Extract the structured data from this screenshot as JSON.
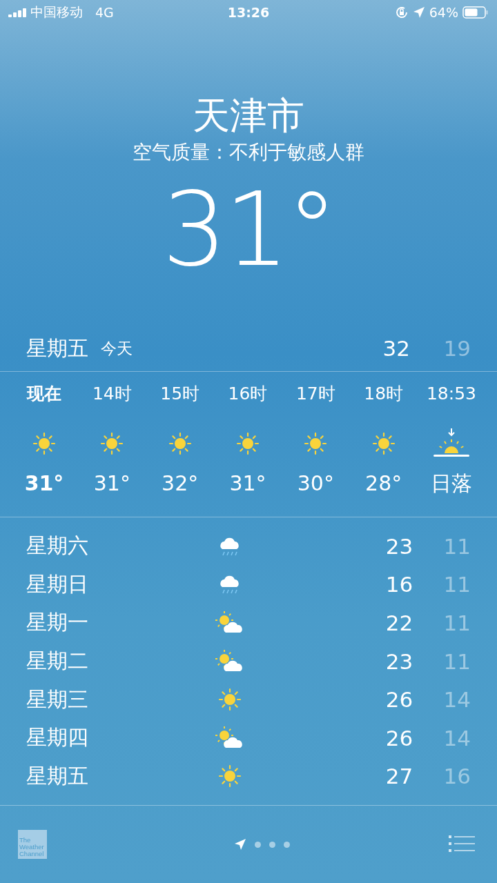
{
  "status_bar": {
    "carrier": "中国移动",
    "network": "4G",
    "time": "13:26",
    "battery": "64%"
  },
  "location": {
    "city": "天津市",
    "air_quality": "空气质量：不利于敏感人群",
    "temperature": "31°"
  },
  "today": {
    "day": "星期五",
    "label": "今天",
    "high": "32",
    "low": "19"
  },
  "hourly": [
    {
      "time": "现在",
      "kind": "sun",
      "temp": "31°",
      "current": true
    },
    {
      "time": "14时",
      "kind": "sun",
      "temp": "31°",
      "current": false
    },
    {
      "time": "15时",
      "kind": "sun",
      "temp": "32°",
      "current": false
    },
    {
      "time": "16时",
      "kind": "sun",
      "temp": "31°",
      "current": false
    },
    {
      "time": "17时",
      "kind": "sun",
      "temp": "30°",
      "current": false
    },
    {
      "time": "18时",
      "kind": "sun",
      "temp": "28°",
      "current": false
    },
    {
      "time": "18:53",
      "kind": "sunset",
      "temp": "日落",
      "current": false
    }
  ],
  "daily": [
    {
      "day": "星期六",
      "kind": "rain",
      "high": "23",
      "low": "11"
    },
    {
      "day": "星期日",
      "kind": "rain",
      "high": "16",
      "low": "11"
    },
    {
      "day": "星期一",
      "kind": "partly",
      "high": "22",
      "low": "11"
    },
    {
      "day": "星期二",
      "kind": "partly",
      "high": "23",
      "low": "11"
    },
    {
      "day": "星期三",
      "kind": "sun",
      "high": "26",
      "low": "14"
    },
    {
      "day": "星期四",
      "kind": "partly",
      "high": "26",
      "low": "14"
    },
    {
      "day": "星期五",
      "kind": "sun",
      "high": "27",
      "low": "16"
    }
  ],
  "bottom_bar": {
    "logo": [
      "The",
      "Weather",
      "Channel"
    ],
    "pages": [
      {
        "kind": "location",
        "selected": true
      },
      {
        "kind": "dot",
        "selected": false
      },
      {
        "kind": "dot",
        "selected": false
      },
      {
        "kind": "dot",
        "selected": false
      }
    ]
  }
}
